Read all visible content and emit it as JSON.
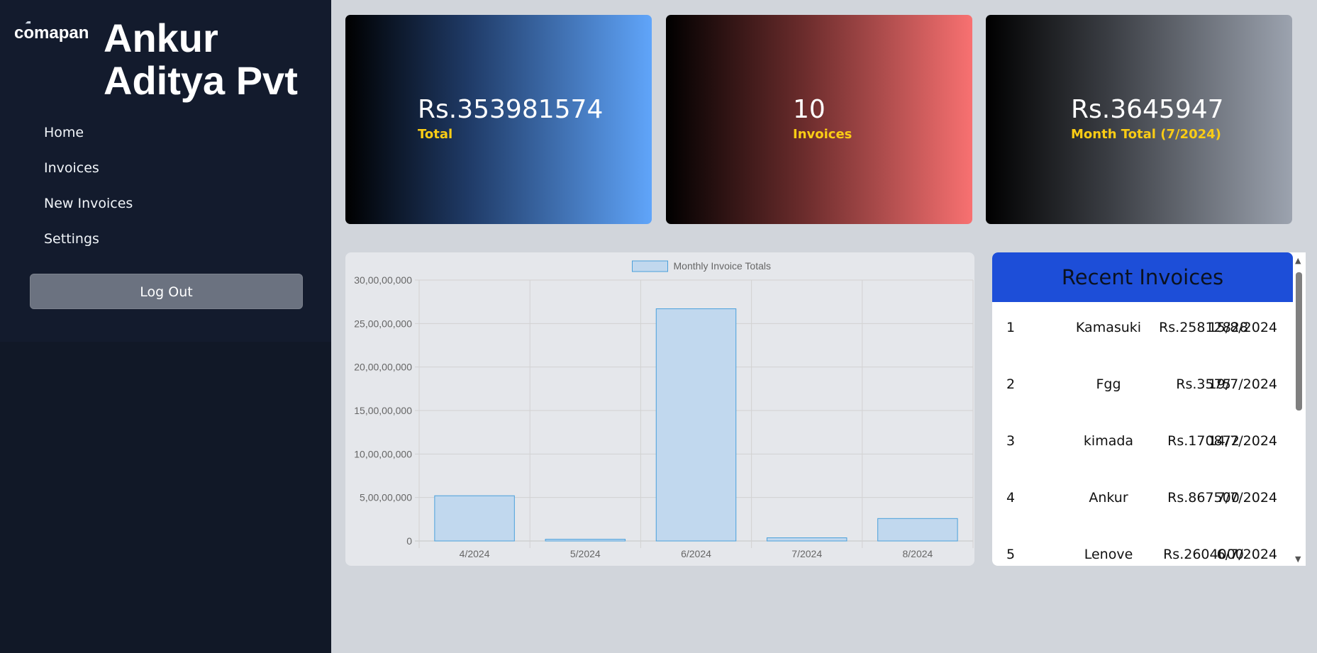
{
  "sidebar": {
    "logo_alt": "comapany logo",
    "company_name": "Ankur\nAditya Pvt",
    "nav": [
      {
        "label": "Home"
      },
      {
        "label": "Invoices"
      },
      {
        "label": "New Invoices"
      },
      {
        "label": "Settings"
      }
    ],
    "logout_label": "Log Out"
  },
  "stats": [
    {
      "value": "Rs.353981574",
      "label": "Total"
    },
    {
      "value": "10",
      "label": "Invoices"
    },
    {
      "value": "Rs.3645947",
      "label": "Month Total (7/2024)"
    }
  ],
  "recent": {
    "title": "Recent Invoices",
    "rows": [
      {
        "idx": "1",
        "name": "Kamasuki",
        "amount": "Rs.25812828",
        "date": "15/8/2024"
      },
      {
        "idx": "2",
        "name": "Fgg",
        "amount": "Rs.3575",
        "date": "19/7/2024"
      },
      {
        "idx": "3",
        "name": "kimada",
        "amount": "Rs.170872",
        "date": "14/7/2024"
      },
      {
        "idx": "4",
        "name": "Ankur",
        "amount": "Rs.867500",
        "date": "7/7/2024"
      },
      {
        "idx": "5",
        "name": "Lenove",
        "amount": "Rs.2604000",
        "date": "6/7/2024"
      }
    ]
  },
  "colors": {
    "bar_fill": "#c1d8ee",
    "bar_stroke": "#4aa0db",
    "accent": "#1d4ed8",
    "label": "#facc15"
  },
  "chart_data": {
    "type": "bar",
    "categories": [
      "4/2024",
      "5/2024",
      "6/2024",
      "7/2024",
      "8/2024"
    ],
    "series": [
      {
        "name": "Monthly Invoice Totals",
        "values": [
          52000000,
          2000000,
          267000000,
          3645947,
          25812828
        ]
      }
    ],
    "ylim": [
      0,
      300000000
    ],
    "yticks": [
      "0",
      "5,00,00,000",
      "10,00,00,000",
      "15,00,00,000",
      "20,00,00,000",
      "25,00,00,000",
      "30,00,00,000"
    ],
    "title": "",
    "xlabel": "",
    "ylabel": "",
    "legend": "top-center",
    "grid": true
  }
}
